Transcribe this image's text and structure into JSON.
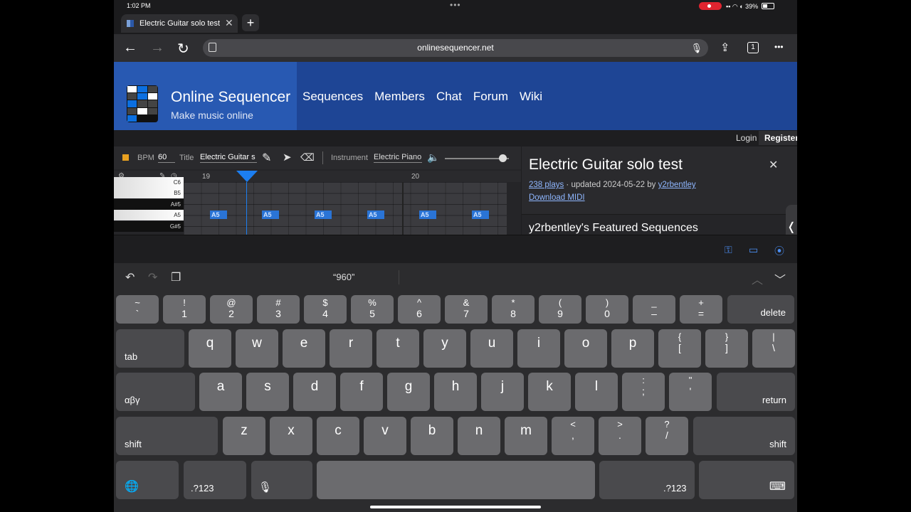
{
  "status": {
    "time": "1:02 PM",
    "dots": "•••",
    "battery": "39%"
  },
  "tab": {
    "title": "Electric Guitar solo test",
    "close": "✕",
    "new": "+"
  },
  "toolbar": {
    "back": "←",
    "forward": "→",
    "reload": "↻",
    "url": "onlinesequencer.net",
    "mic": "🎙",
    "share": "⇪",
    "tabs": "1",
    "more": "•••"
  },
  "site": {
    "title": "Online Sequencer",
    "subtitle": "Make music online",
    "nav": [
      "Sequences",
      "Members",
      "Chat",
      "Forum",
      "Wiki"
    ],
    "login": "Login",
    "register": "Register"
  },
  "sequencer": {
    "bpm_label": "BPM",
    "bpm_value": "60",
    "title_label": "Title",
    "title_value": "Electric Guitar s",
    "instrument_label": "Instrument",
    "instrument_value": "Electric Piano",
    "volume": 0.9,
    "measures": [
      "19",
      "20"
    ],
    "keys": [
      {
        "label": "C6",
        "color": "white"
      },
      {
        "label": "B5",
        "color": "white"
      },
      {
        "label": "A#5",
        "color": "black"
      },
      {
        "label": "A5",
        "color": "white"
      },
      {
        "label": "G#5",
        "color": "black"
      }
    ],
    "note_label": "A5",
    "notes": [
      {
        "label": "A5"
      },
      {
        "label": "A5"
      },
      {
        "label": "A5"
      },
      {
        "label": "A5"
      },
      {
        "label": "A5"
      },
      {
        "label": "A5"
      }
    ]
  },
  "info": {
    "title": "Electric Guitar solo test",
    "close": "✕",
    "plays": "238 plays",
    "updated": " · updated 2024-05-22 by ",
    "author": "y2rbentley",
    "download": "Download MIDI",
    "featured": "y2rbentley's Featured Sequences",
    "handle": "❬"
  },
  "keyboard": {
    "suggestion": "“960”",
    "number_row": [
      {
        "top": "~",
        "bot": "`"
      },
      {
        "top": "!",
        "bot": "1"
      },
      {
        "top": "@",
        "bot": "2"
      },
      {
        "top": "#",
        "bot": "3"
      },
      {
        "top": "$",
        "bot": "4"
      },
      {
        "top": "%",
        "bot": "5"
      },
      {
        "top": "^",
        "bot": "6"
      },
      {
        "top": "&",
        "bot": "7"
      },
      {
        "top": "*",
        "bot": "8"
      },
      {
        "top": "(",
        "bot": "9"
      },
      {
        "top": ")",
        "bot": "0"
      },
      {
        "top": "_",
        "bot": "–"
      },
      {
        "top": "+",
        "bot": "="
      }
    ],
    "delete": "delete",
    "tab": "tab",
    "row_q": [
      "q",
      "w",
      "e",
      "r",
      "t",
      "y",
      "u",
      "i",
      "o",
      "p"
    ],
    "row_q_extra": [
      {
        "top": "{",
        "bot": "["
      },
      {
        "top": "}",
        "bot": "]"
      },
      {
        "top": "|",
        "bot": "\\"
      }
    ],
    "alt": "αβγ",
    "row_a": [
      "a",
      "s",
      "d",
      "f",
      "g",
      "h",
      "j",
      "k",
      "l"
    ],
    "row_a_extra": [
      {
        "top": ":",
        "bot": ";"
      },
      {
        "top": "\"",
        "bot": "'"
      }
    ],
    "return": "return",
    "shift": "shift",
    "row_z": [
      "z",
      "x",
      "c",
      "v",
      "b",
      "n",
      "m"
    ],
    "row_z_extra": [
      {
        "top": "<",
        "bot": ","
      },
      {
        "top": ">",
        "bot": "."
      },
      {
        "top": "?",
        "bot": "/"
      }
    ],
    "num_toggle": ".?123",
    "globe": "🌐",
    "mic": "🎙",
    "dismiss": "⌨"
  }
}
